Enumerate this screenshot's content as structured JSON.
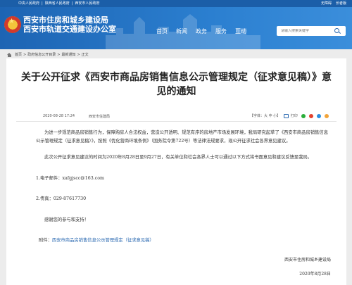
{
  "topbar": {
    "links": [
      "中央人民政府",
      "|",
      "陕西省人民政府",
      "|",
      "西安市人民政府"
    ],
    "right": [
      "无障碍",
      "长者版"
    ]
  },
  "header": {
    "title_line1": "西安市住房和城乡建设局",
    "title_line2": "西安市轨道交通建设办公室",
    "nav": [
      "首页",
      "新闻",
      "政务",
      "服务",
      "互动"
    ],
    "search_placeholder": "请输入搜索关键字"
  },
  "breadcrumb": {
    "items": [
      "首页",
      ">",
      "政府信息公开目录",
      ">",
      "最新通知",
      ">",
      "正文"
    ]
  },
  "article": {
    "title": "关于公开征求《西安市商品房销售信息公示管理规定（征求意见稿）》意见的通知",
    "date": "2020-08-28 17:24",
    "source": "西安市住建局",
    "font_label": "【字体：大 中 小】",
    "print_label": "打印",
    "paragraph1": "为进一步规范商品房销售行为，保障购房人合法权益，营造公开透明、规范有序的房地产市场发展环境，我局研究起草了《西安市商品房销售信息公示管理规定（征求意见稿）》，按照《优化营商环境条例》（国务院令第722号）等法律法规要求，现公开征求社会各界意见建议。",
    "paragraph2": "此次公开征求意见建议的时间为2020年8月28日至9月27日，有关单位和社会各界人士可以通过以下方式将书面意见和建议反馈至我局。",
    "item1": "1.电子邮件：xafgjscc@163.com",
    "item2": "2.传真：029-87617730",
    "thanks": "感谢您的参与和支持！",
    "attach_label": "附件：",
    "attach_link": "西安市商品房销售信息公示管理规定（征求意见稿）",
    "sign_org": "西安市住房和城乡建设局",
    "sign_date": "2020年8月28日"
  },
  "colors": {
    "topbar": "#1b5ea8",
    "header_gradient_start": "#1d64b3",
    "header_gradient_end": "#3b8edb",
    "link": "#2767b0"
  }
}
